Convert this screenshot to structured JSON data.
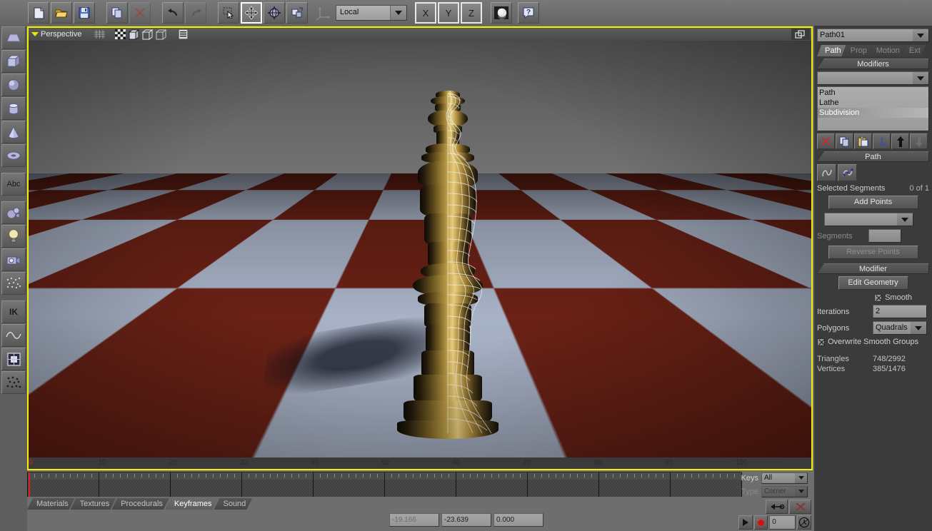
{
  "toolbar": {
    "buttons": [
      {
        "name": "new-file-button",
        "icon": "document-icon"
      },
      {
        "name": "open-file-button",
        "icon": "folder-open-icon"
      },
      {
        "name": "save-file-button",
        "icon": "floppy-disk-icon"
      },
      {
        "name": "copy-button",
        "icon": "copy-icon"
      },
      {
        "name": "delete-button",
        "icon": "red-x-icon"
      },
      {
        "name": "undo-button",
        "icon": "undo-arrow-icon"
      },
      {
        "name": "redo-button",
        "icon": "redo-arrow-icon"
      },
      {
        "name": "select-tool-button",
        "icon": "select-cursor-icon"
      },
      {
        "name": "move-tool-button",
        "icon": "move-arrows-icon"
      },
      {
        "name": "rotate-tool-button",
        "icon": "rotate-globe-icon"
      },
      {
        "name": "scale-tool-button",
        "icon": "scale-box-icon"
      }
    ],
    "coordsys_label": "Local",
    "axis_x": "X",
    "axis_y": "Y",
    "axis_z": "Z",
    "render_icon": "render-sphere-icon",
    "help_icon": "help-question-icon"
  },
  "left_rail": {
    "items": [
      {
        "name": "rail-primitive-plane",
        "icon": "plane-primitive-icon",
        "label": ""
      },
      {
        "name": "rail-primitive-cube",
        "icon": "cube-primitive-icon",
        "label": ""
      },
      {
        "name": "rail-primitive-sphere",
        "icon": "sphere-primitive-icon",
        "label": ""
      },
      {
        "name": "rail-primitive-cylinder",
        "icon": "cylinder-primitive-icon",
        "label": ""
      },
      {
        "name": "rail-primitive-cone",
        "icon": "cone-primitive-icon",
        "label": ""
      },
      {
        "name": "rail-primitive-torus",
        "icon": "torus-primitive-icon",
        "label": ""
      },
      {
        "name": "rail-text-tool",
        "icon": "text-abc-icon",
        "label": "Abc"
      },
      {
        "name": "rail-metaball-tool",
        "icon": "metaball-icon",
        "label": ""
      },
      {
        "name": "rail-light-tool",
        "icon": "lightbulb-icon",
        "label": ""
      },
      {
        "name": "rail-camera-tool",
        "icon": "camera-icon",
        "label": ""
      },
      {
        "name": "rail-particle-tool",
        "icon": "particles-icon",
        "label": ""
      },
      {
        "name": "rail-ik-tool",
        "icon": "ik-chain-icon",
        "label": "IK"
      },
      {
        "name": "rail-spline-tool",
        "icon": "spline-curve-icon",
        "label": ""
      },
      {
        "name": "rail-uv-tool",
        "icon": "uv-grid-icon",
        "label": ""
      },
      {
        "name": "rail-scatter-tool",
        "icon": "scatter-dots-icon",
        "label": ""
      }
    ]
  },
  "viewport": {
    "title": "Perspective",
    "header_icons": [
      {
        "name": "grid-toggle-icon"
      },
      {
        "name": "textured-shading-icon"
      },
      {
        "name": "solid-shading-icon"
      },
      {
        "name": "wireframe-shading-icon"
      },
      {
        "name": "boundingbox-shading-icon"
      },
      {
        "name": "viewport-options-icon"
      }
    ],
    "maximize_icon": "maximize-viewport-icon",
    "scene_description": "Rendered chess queen on a red-and-white checkerboard floor with wireframe overlay",
    "colors": {
      "selection_border": "#f2f200",
      "floor_light": "#a8b2c6",
      "floor_dark": "#6b2216",
      "background_sky": "#6a6a6a"
    },
    "ruler_ticks": [
      "0",
      "10",
      "20",
      "30",
      "40",
      "50",
      "60",
      "70",
      "80",
      "90",
      "100"
    ]
  },
  "timeline": {
    "playhead_frame": "0",
    "keys": {
      "label": "Keys",
      "value": "All"
    },
    "type": {
      "label": "Type",
      "value": "Corner"
    },
    "frame_markers": [
      "0",
      "10",
      "20",
      "30",
      "40",
      "50",
      "60",
      "70",
      "80",
      "90",
      "100"
    ]
  },
  "bottom_tabs": {
    "items": [
      {
        "label": "Materials",
        "active": false
      },
      {
        "label": "Textures",
        "active": false
      },
      {
        "label": "Procedurals",
        "active": false
      },
      {
        "label": "Keyframes",
        "active": true
      },
      {
        "label": "Sound",
        "active": false
      }
    ]
  },
  "status_fields": [
    {
      "name": "coord-x-field",
      "value": "-19.166",
      "dim": true
    },
    {
      "name": "coord-y-field",
      "value": "-23.639",
      "dim": false
    },
    {
      "name": "coord-z-field",
      "value": "0.000",
      "dim": false
    }
  ],
  "anim_controls": {
    "prev_key_icon": "previous-key-icon",
    "delete_key_icon": "delete-key-red-x-icon",
    "play_icon": "play-icon",
    "record_icon": "record-dot-icon",
    "frame_value": "0",
    "clock_icon": "clock-icon"
  },
  "right_panel": {
    "object_name": "Path01",
    "tabs": [
      {
        "label": "Path",
        "active": true
      },
      {
        "label": "Prop",
        "active": false
      },
      {
        "label": "Motion",
        "active": false
      },
      {
        "label": "Ext",
        "active": false
      }
    ],
    "modifiers_section": {
      "title": "Modifiers",
      "dropdown_value": "",
      "list": [
        {
          "label": "Path",
          "selected": false
        },
        {
          "label": "Lathe",
          "selected": false
        },
        {
          "label": "Subdivision",
          "selected": true
        }
      ],
      "buttons": [
        {
          "name": "delete-modifier-button",
          "icon": "red-x-icon"
        },
        {
          "name": "copy-modifier-button",
          "icon": "copy-icon"
        },
        {
          "name": "paste-modifier-button",
          "icon": "paste-clipboard-icon"
        },
        {
          "name": "gizmo-modifier-button",
          "icon": "axis-gizmo-icon"
        },
        {
          "name": "move-modifier-up-button",
          "icon": "arrow-up-icon"
        },
        {
          "name": "move-modifier-down-button",
          "icon": "arrow-down-icon"
        }
      ]
    },
    "path_section": {
      "title": "Path",
      "buttons": [
        {
          "name": "edit-path-curve-button",
          "icon": "spline-curve-icon"
        },
        {
          "name": "edit-path-points-button",
          "icon": "spline-points-icon"
        }
      ],
      "selected_segments_label": "Selected Segments",
      "selected_segments_value": "0 of 1",
      "add_points_label": "Add Points",
      "segment_type_value": "",
      "segments_label": "Segments",
      "segments_value": "",
      "reverse_points_label": "Reverse Points"
    },
    "modifier_section": {
      "title": "Modifier",
      "edit_geometry_label": "Edit Geometry",
      "smooth_label": "Smooth",
      "smooth_checked": true,
      "iterations_label": "Iterations",
      "iterations_value": "2",
      "polygons_label": "Polygons",
      "polygons_value": "Quadrals",
      "overwrite_label": "Overwrite Smooth Groups",
      "overwrite_checked": true,
      "triangles_label": "Triangles",
      "triangles_value": "748/2992",
      "vertices_label": "Vertices",
      "vertices_value": "385/1476"
    }
  }
}
